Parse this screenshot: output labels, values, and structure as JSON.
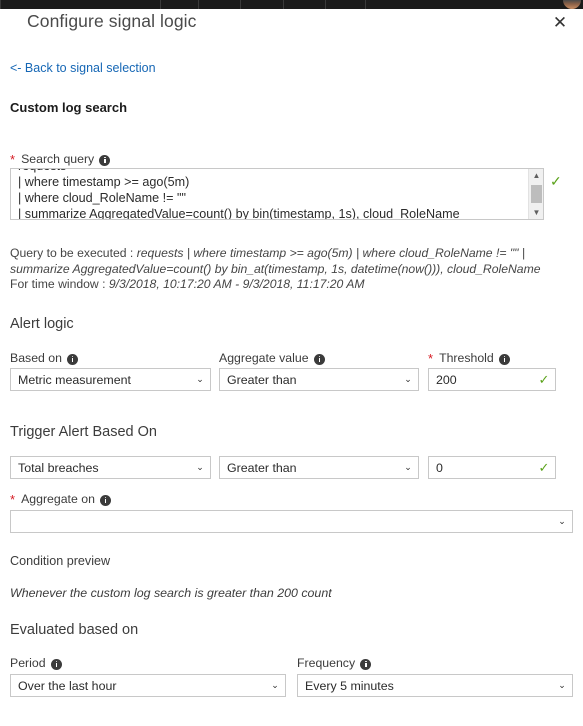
{
  "window": {
    "blade_title": "Configure signal logic",
    "close_icon": "close-icon",
    "avatar_icon": "user-avatar-icon"
  },
  "back_link": {
    "label": "<- Back to signal selection"
  },
  "sections": {
    "custom_log_search": "Custom log search",
    "alert_logic": "Alert logic",
    "trigger_alert": "Trigger Alert Based On",
    "condition_preview": "Condition preview",
    "evaluated_based_on": "Evaluated based on"
  },
  "search_query": {
    "label": "Search query",
    "required": true,
    "info_icon": "info-icon",
    "validation_icon": "valid-check-icon",
    "lines": [
      "requests",
      "| where timestamp >= ago(5m)",
      "| where cloud_RoleName != \"\"",
      "| summarize AggregatedValue=count() by bin(timestamp, 1s), cloud_RoleName"
    ],
    "value": "requests\n| where timestamp >= ago(5m)\n| where cloud_RoleName != \"\"\n| summarize AggregatedValue=count() by bin(timestamp, 1s), cloud_RoleName",
    "scrollbar": {
      "up_arrow_icon": "scroll-up-icon",
      "down_arrow_icon": "scroll-down-icon"
    }
  },
  "query_preview": {
    "executed_prefix": "Query to be executed : ",
    "executed_query": "requests | where timestamp >= ago(5m) | where cloud_RoleName != \"\" | summarize AggregatedValue=count() by bin_at(timestamp, 1s, datetime(now())), cloud_RoleName",
    "time_window_prefix": "For time window : ",
    "time_window": "9/3/2018, 10:17:20 AM - 9/3/2018, 11:17:20 AM"
  },
  "alert_logic": {
    "based_on": {
      "label": "Based on",
      "info_icon": "info-icon",
      "value": "Metric measurement",
      "chevron_icon": "chevron-down-icon"
    },
    "aggregate_value": {
      "label": "Aggregate value",
      "info_icon": "info-icon",
      "value": "Greater than",
      "chevron_icon": "chevron-down-icon"
    },
    "threshold": {
      "label": "Threshold",
      "required": true,
      "info_icon": "info-icon",
      "value": "200",
      "validation_icon": "valid-check-icon"
    }
  },
  "trigger_alert": {
    "breach_type": {
      "value": "Total breaches",
      "chevron_icon": "chevron-down-icon"
    },
    "operator": {
      "value": "Greater than",
      "chevron_icon": "chevron-down-icon"
    },
    "count": {
      "value": "0",
      "validation_icon": "valid-check-icon"
    },
    "aggregate_on": {
      "label": "Aggregate on",
      "required": true,
      "info_icon": "info-icon",
      "value": "",
      "chevron_icon": "chevron-down-icon"
    }
  },
  "condition_preview": {
    "text": "Whenever the custom log search is greater than 200 count"
  },
  "evaluated": {
    "period": {
      "label": "Period",
      "info_icon": "info-icon",
      "value": "Over the last hour",
      "chevron_icon": "chevron-down-icon"
    },
    "frequency": {
      "label": "Frequency",
      "info_icon": "info-icon",
      "value": "Every 5 minutes",
      "chevron_icon": "chevron-down-icon"
    }
  },
  "colors": {
    "link": "#1667b5",
    "required": "#d61b23",
    "valid": "#5aa21a",
    "topbar": "#1b1b1b"
  }
}
